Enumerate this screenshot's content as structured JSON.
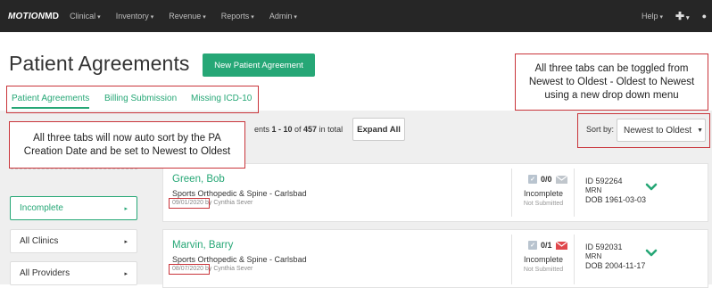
{
  "nav": {
    "brand_a": "MOTION",
    "brand_b": "MD",
    "items": [
      "Clinical",
      "Inventory",
      "Revenue",
      "Reports",
      "Admin"
    ],
    "help": "Help",
    "plus": "✚"
  },
  "page": {
    "title": "Patient Agreements",
    "new_button": "New Patient Agreement"
  },
  "tabs": [
    "Patient Agreements",
    "Billing Submission",
    "Missing ICD-10"
  ],
  "list": {
    "count_prefix": "ents ",
    "range": "1 - 10",
    "of": " of ",
    "total": "457",
    "in_total": " in total",
    "expand_all": "Expand All",
    "sort_label": "Sort by:",
    "sort_value": "Newest to Oldest"
  },
  "filters": [
    "Incomplete",
    "All Clinics",
    "All Providers"
  ],
  "rows": [
    {
      "name": "Green, Bob",
      "clinic": "Sports Orthopedic & Spine - Carlsbad",
      "date": "09/01/2020",
      "by": " by Cynthia Sever",
      "docs": "0/0",
      "status": "Incomplete",
      "substatus": "Not Submitted",
      "id": "ID 592264",
      "mrn": "MRN",
      "dob": "DOB 1961-03-03",
      "mail_color": "#c0c6cc"
    },
    {
      "name": "Marvin, Barry",
      "clinic": "Sports Orthopedic & Spine - Carlsbad",
      "date": "08/07/2020",
      "by": " by Cynthia Sever",
      "docs": "0/1",
      "status": "Incomplete",
      "substatus": "Not Submitted",
      "id": "ID 592031",
      "mrn": "MRN",
      "dob": "DOB 2004-11-17",
      "mail_color": "#e0474c"
    }
  ],
  "callouts": {
    "tabs_sort": "All three tabs can be toggled from Newest to Oldest - Oldest to Newest using a new drop down menu",
    "auto_sort": "All three tabs will now auto sort by the PA Creation Date and be set to Newest to Oldest"
  },
  "colors": {
    "accent": "#26a776",
    "annotation": "#c9343a",
    "nav_bg": "#262626"
  }
}
